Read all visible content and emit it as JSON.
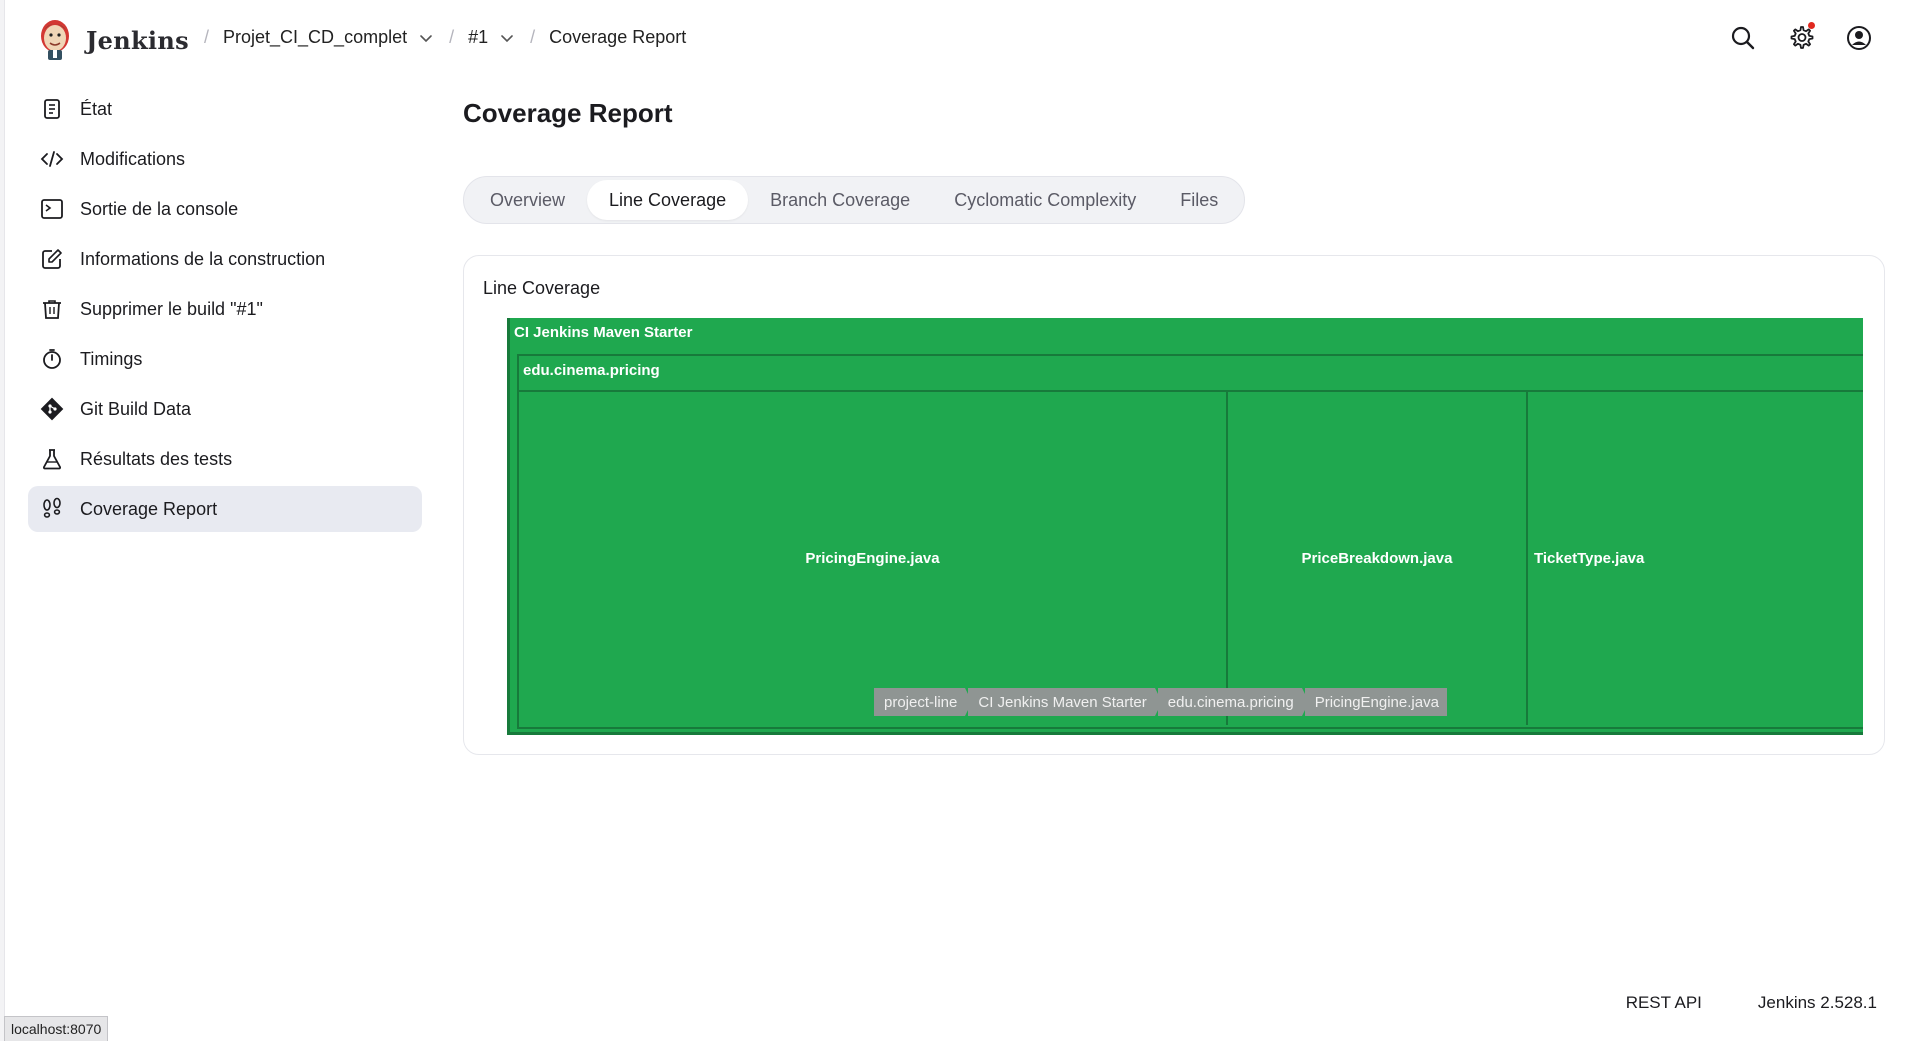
{
  "header": {
    "brand": "Jenkins",
    "breadcrumbs": [
      {
        "label": "Projet_CI_CD_complet",
        "dropdown": true
      },
      {
        "label": "#1",
        "dropdown": true
      },
      {
        "label": "Coverage Report",
        "dropdown": false
      }
    ],
    "actions": [
      "search-icon",
      "gear-icon",
      "user-icon"
    ]
  },
  "sidebar": {
    "items": [
      {
        "label": "État",
        "icon": "notepad-icon"
      },
      {
        "label": "Modifications",
        "icon": "code-icon"
      },
      {
        "label": "Sortie de la console",
        "icon": "terminal-icon"
      },
      {
        "label": "Informations de la construction",
        "icon": "edit-icon"
      },
      {
        "label": "Supprimer le build \"#1\"",
        "icon": "trash-icon"
      },
      {
        "label": "Timings",
        "icon": "stopwatch-icon"
      },
      {
        "label": "Git Build Data",
        "icon": "git-icon"
      },
      {
        "label": "Résultats des tests",
        "icon": "flask-icon"
      },
      {
        "label": "Coverage Report",
        "icon": "footsteps-icon",
        "active": true
      }
    ]
  },
  "main": {
    "title": "Coverage Report",
    "tabs": [
      "Overview",
      "Line Coverage",
      "Branch Coverage",
      "Cyclomatic Complexity",
      "Files"
    ],
    "active_tab": "Line Coverage",
    "card_title": "Line Coverage",
    "treemap": {
      "root": "CI Jenkins Maven Starter",
      "package": "edu.cinema.pricing",
      "files": [
        "PricingEngine.java",
        "PriceBreakdown.java",
        "TicketType.java"
      ],
      "breadcrumb": [
        "project-line",
        "CI Jenkins Maven Starter",
        "edu.cinema.pricing",
        "PricingEngine.java"
      ],
      "fill_color": "#1fa84f",
      "border_color": "#177a3b"
    }
  },
  "footer": {
    "rest_api": "REST API",
    "version": "Jenkins 2.528.1"
  },
  "status_url": "localhost:8070"
}
